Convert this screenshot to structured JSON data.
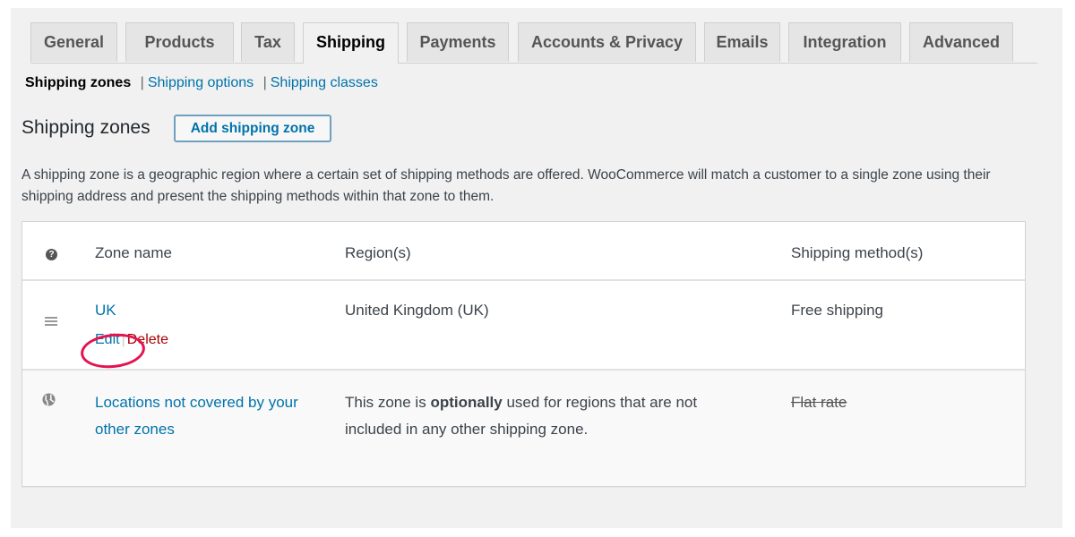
{
  "tabs": [
    {
      "label": "General",
      "active": false
    },
    {
      "label": "Products",
      "active": false
    },
    {
      "label": "Tax",
      "active": false
    },
    {
      "label": "Shipping",
      "active": true
    },
    {
      "label": "Payments",
      "active": false
    },
    {
      "label": "Accounts & Privacy",
      "active": false
    },
    {
      "label": "Emails",
      "active": false
    },
    {
      "label": "Integration",
      "active": false
    },
    {
      "label": "Advanced",
      "active": false
    }
  ],
  "subnav": {
    "current": "Shipping zones",
    "separator": "|",
    "links": [
      "Shipping options",
      "Shipping classes"
    ]
  },
  "heading": {
    "title": "Shipping zones",
    "add_button": "Add shipping zone"
  },
  "description": "A shipping zone is a geographic region where a certain set of shipping methods are offered. WooCommerce will match a customer to a single zone using their shipping address and present the shipping methods within that zone to them.",
  "table": {
    "headers": {
      "help_icon": "question-circle-icon",
      "zone_name": "Zone name",
      "regions": "Region(s)",
      "methods": "Shipping method(s)"
    },
    "rows": [
      {
        "handle_icon": "drag-handle-icon",
        "zone_name": "UK",
        "actions": {
          "edit": "Edit",
          "separator": "|",
          "delete": "Delete"
        },
        "regions": "United Kingdom (UK)",
        "methods": "Free shipping"
      }
    ],
    "rest_of_world": {
      "icon": "globe-icon",
      "zone_name": "Locations not covered by your other zones",
      "regions_prefix": "This zone is ",
      "regions_bold": "optionally",
      "regions_suffix": " used for regions that are not included in any other shipping zone.",
      "methods": "Flat rate"
    }
  },
  "annotation": {
    "target": "Edit",
    "color": "#e4134f"
  },
  "colors": {
    "link": "#0073aa",
    "delete": "#aa0000",
    "background": "#f1f1f1"
  }
}
